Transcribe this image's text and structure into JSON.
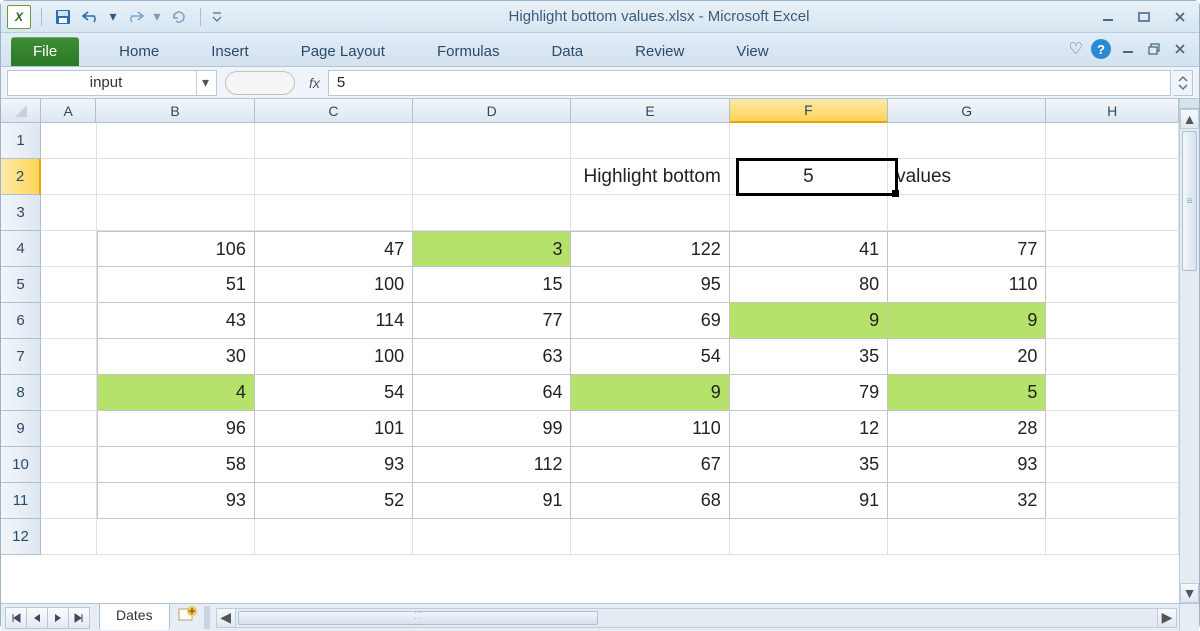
{
  "app_title": "Highlight bottom values.xlsx - Microsoft Excel",
  "qat": {
    "save": "Save",
    "undo": "Undo",
    "redo": "Redo",
    "refresh": "Refresh"
  },
  "ribbon": {
    "file": "File",
    "tabs": [
      "Home",
      "Insert",
      "Page Layout",
      "Formulas",
      "Data",
      "Review",
      "View"
    ]
  },
  "namebox": "input",
  "fx_label": "fx",
  "formula_value": "5",
  "columns": [
    {
      "letter": "A",
      "width": 56
    },
    {
      "letter": "B",
      "width": 160
    },
    {
      "letter": "C",
      "width": 160
    },
    {
      "letter": "D",
      "width": 160
    },
    {
      "letter": "E",
      "width": 160
    },
    {
      "letter": "F",
      "width": 160
    },
    {
      "letter": "G",
      "width": 160
    },
    {
      "letter": "H",
      "width": 134
    }
  ],
  "selected_col": "F",
  "selected_row": 2,
  "row_heights_count": 12,
  "label_before": "Highlight bottom",
  "input_value": "5",
  "label_after": "values",
  "data_start_row": 4,
  "data_start_col": "B",
  "data": [
    [
      106,
      47,
      3,
      122,
      41,
      77
    ],
    [
      51,
      100,
      15,
      95,
      80,
      110
    ],
    [
      43,
      114,
      77,
      69,
      9,
      9
    ],
    [
      30,
      100,
      63,
      54,
      35,
      20
    ],
    [
      4,
      54,
      64,
      9,
      79,
      5
    ],
    [
      96,
      101,
      99,
      110,
      12,
      28
    ],
    [
      58,
      93,
      112,
      67,
      35,
      93
    ],
    [
      93,
      52,
      91,
      68,
      91,
      32
    ]
  ],
  "highlighted": [
    [
      0,
      2
    ],
    [
      2,
      4
    ],
    [
      2,
      5
    ],
    [
      4,
      0
    ],
    [
      4,
      3
    ],
    [
      4,
      5
    ]
  ],
  "sheet_tab": "Dates"
}
